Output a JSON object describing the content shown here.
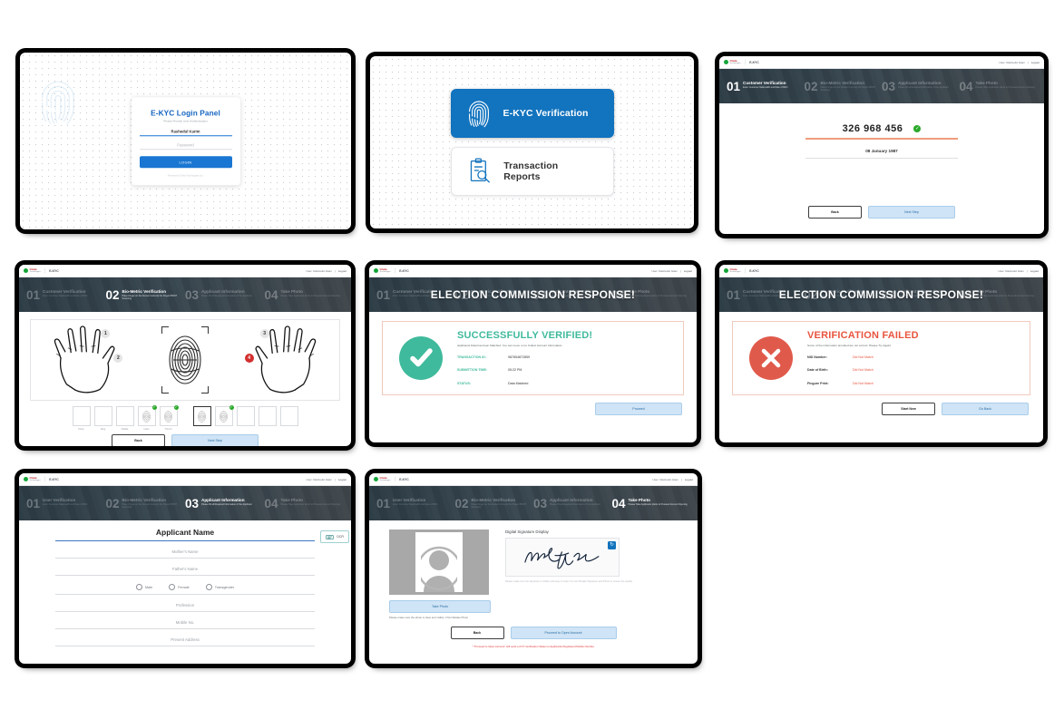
{
  "brand": {
    "name": "Chata",
    "subtitle": "Technologies",
    "app": "E-KYC",
    "user_label": "User: Rashedul Islam",
    "separator": "|",
    "logout": "Logout"
  },
  "login": {
    "title": "E-KYC Login Panel",
    "subtitle": "Please Provide User Authentication",
    "username_value": "Rashedul Karim",
    "password_placeholder": "Password",
    "login_button": "LOGIN",
    "footer": "Powered by Chata Technologies Ltd."
  },
  "menu": {
    "items": [
      {
        "label": "E-KYC Verification",
        "icon": "fingerprint-icon"
      },
      {
        "label": "Transaction Reports",
        "icon": "report-search-icon"
      }
    ]
  },
  "steps_customer": [
    {
      "num": "01",
      "title": "Customer Verification",
      "sub": "Enter Customer NationalID and Date of Birth"
    },
    {
      "num": "02",
      "title": "Bio-Metric Verification",
      "sub": "Place Finger on the Sensor Correctly for Finger PRINT Scanning"
    },
    {
      "num": "03",
      "title": "Applicant Information",
      "sub": "Please fill all Required Information of the Applicant"
    },
    {
      "num": "04",
      "title": "Take Photo",
      "sub": "Please Take Applicants photo to Proceed Account Opening"
    }
  ],
  "steps_user": [
    {
      "num": "01",
      "title": "User Verification",
      "sub": "Enter Customer NationalID and Date of Birth"
    },
    {
      "num": "02",
      "title": "Bio-Metric Verification",
      "sub": "Place Finger on the Sensor Correctly for Finger PRINT Scanning"
    },
    {
      "num": "03",
      "title": "Applicant Information",
      "sub": "Please fill all Required Information of the Applicant"
    },
    {
      "num": "04",
      "title": "Take Photo",
      "sub": "Please Take Applicants photo to Proceed Account Opening"
    }
  ],
  "customer_verification": {
    "nid_value": "326 968 456",
    "status_icon": "check-circle-icon",
    "dob_value": "08 January 1987",
    "back_button": "Back",
    "next_button": "Next Step"
  },
  "biometric": {
    "markers": [
      "1",
      "2",
      "3",
      "4"
    ],
    "left_slots": [
      {
        "label": "Pinky",
        "captured": false,
        "verified": false,
        "selected": false
      },
      {
        "label": "Ring",
        "captured": false,
        "verified": false,
        "selected": false
      },
      {
        "label": "Middle",
        "captured": false,
        "verified": false,
        "selected": false
      },
      {
        "label": "Index",
        "captured": true,
        "verified": true,
        "selected": false
      },
      {
        "label": "Thumb",
        "captured": true,
        "verified": true,
        "selected": false
      }
    ],
    "right_slots": [
      {
        "label": "",
        "captured": true,
        "verified": false,
        "selected": true
      },
      {
        "label": "",
        "captured": true,
        "verified": true,
        "selected": false
      },
      {
        "label": "",
        "captured": false,
        "verified": false,
        "selected": false
      },
      {
        "label": "",
        "captured": false,
        "verified": false,
        "selected": false
      },
      {
        "label": "",
        "captured": false,
        "verified": false,
        "selected": false
      }
    ],
    "back_button": "Back",
    "next_button": "Next Step"
  },
  "response_banner": "ELECTION COMMISSION RESPONSE!",
  "success": {
    "title": "SUCCESSFULLY VERIFIED!",
    "subtitle": "Applicants Data has been Matched. You can move on to Collect Account Information.",
    "rows": [
      {
        "key": "TRANSACTION ID:",
        "value": "987654872859"
      },
      {
        "key": "SUBMITTION TIME:",
        "value": "05:22 PM"
      },
      {
        "key": "STATUS:",
        "value": "Data Matched"
      }
    ],
    "proceed_button": "Proceed",
    "icon": "check-mark-icon"
  },
  "failure": {
    "title": "VERIFICATION FAILED",
    "subtitle": "Some of the information provided are not correct. Please Try Again!",
    "rows": [
      {
        "key": "NID Number:",
        "value": "Did Not Match"
      },
      {
        "key": "Date of Birth:",
        "value": "Did Not Match"
      },
      {
        "key": "Fingure Print:",
        "value": "Did Not Match"
      }
    ],
    "start_new_button": "Start New",
    "go_back_button": "Go Back",
    "icon": "cross-mark-icon"
  },
  "applicant_form": {
    "name_value": "Applicant Name",
    "ocr_button": "OCR",
    "fields": [
      "Mother's Name",
      "Father's Name",
      "Profession",
      "Mobile No.",
      "Present Address"
    ],
    "gender_options": [
      "Male",
      "Female",
      "Transgender"
    ]
  },
  "take_photo": {
    "take_photo_button": "Take Photo",
    "photo_note": "Please make sure the photo is clear and visible, if Not Retake Photo",
    "signature_title": "Digital Signature Display",
    "signature_reload_icon": "refresh-icon",
    "signature_help": "Please make sure the signature is visible and easy to read. You can Retake Signature and Photo to ensure the quality.",
    "back_button": "Back",
    "proceed_button": "Proceed to Open Account",
    "red_note": "* \"Proceed to Open Account\" will send e-KYC Verification Status to Applicants Registered Mobile Number."
  },
  "colors": {
    "primary": "#1273be",
    "success": "#3fba9c",
    "danger": "#e8553f",
    "stepper_bg": "#2b3a44"
  }
}
